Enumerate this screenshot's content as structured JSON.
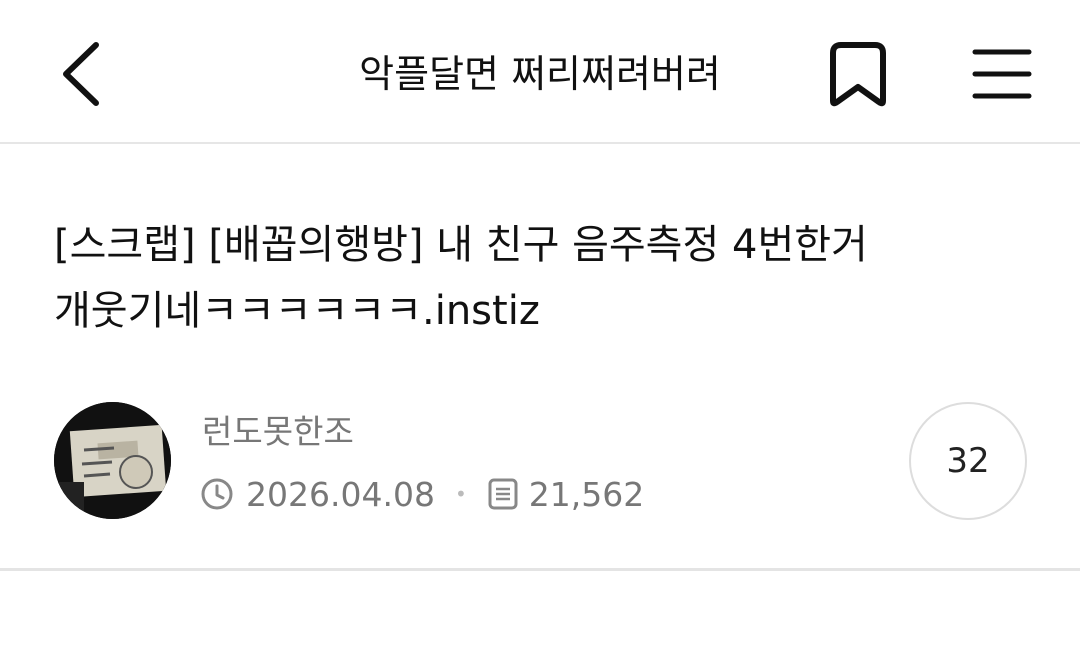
{
  "header": {
    "board_title": "악플달면 쩌리쩌려버려",
    "back_icon": "chevron-left-icon",
    "bookmark_icon": "bookmark-icon",
    "menu_icon": "hamburger-menu-icon"
  },
  "post": {
    "title": "[스크랩] [배꼽의행방] 내 친구 음주측정 4번한거 개웃기네ㅋㅋㅋㅋㅋㅋ.instiz",
    "author": "런도못한조",
    "date": "2026.04.08",
    "views": "21,562",
    "comment_count": "32",
    "date_icon": "clock-icon",
    "views_icon": "document-icon",
    "separator": "•"
  },
  "colors": {
    "text": "#111111",
    "meta": "#777777",
    "border": "#e6e6e6"
  }
}
